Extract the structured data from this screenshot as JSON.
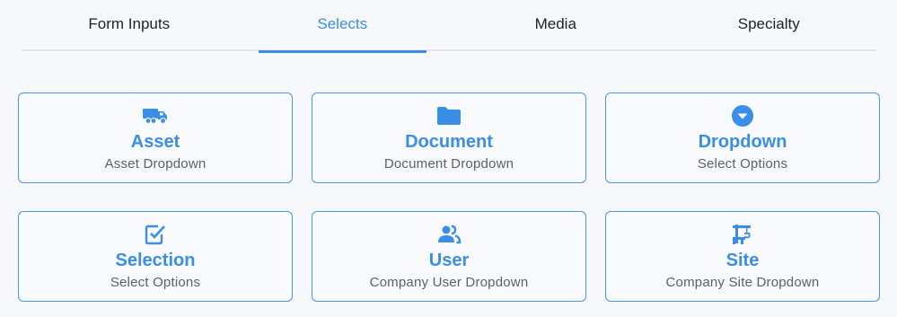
{
  "tabs": [
    {
      "label": "Form Inputs",
      "active": false
    },
    {
      "label": "Selects",
      "active": true
    },
    {
      "label": "Media",
      "active": false
    },
    {
      "label": "Specialty",
      "active": false
    }
  ],
  "cards": [
    {
      "icon": "truck-icon",
      "title": "Asset",
      "subtitle": "Asset Dropdown"
    },
    {
      "icon": "folder-icon",
      "title": "Document",
      "subtitle": "Document Dropdown"
    },
    {
      "icon": "caret-down-circle-icon",
      "title": "Dropdown",
      "subtitle": "Select Options"
    },
    {
      "icon": "checkbox-icon",
      "title": "Selection",
      "subtitle": "Select Options"
    },
    {
      "icon": "users-icon",
      "title": "User",
      "subtitle": "Company User Dropdown"
    },
    {
      "icon": "crane-icon",
      "title": "Site",
      "subtitle": "Company Site Dropdown"
    }
  ],
  "colors": {
    "accent": "#3b8ee8",
    "border": "#4a95e8",
    "text": "#1e2126",
    "muted": "#5b6169"
  }
}
